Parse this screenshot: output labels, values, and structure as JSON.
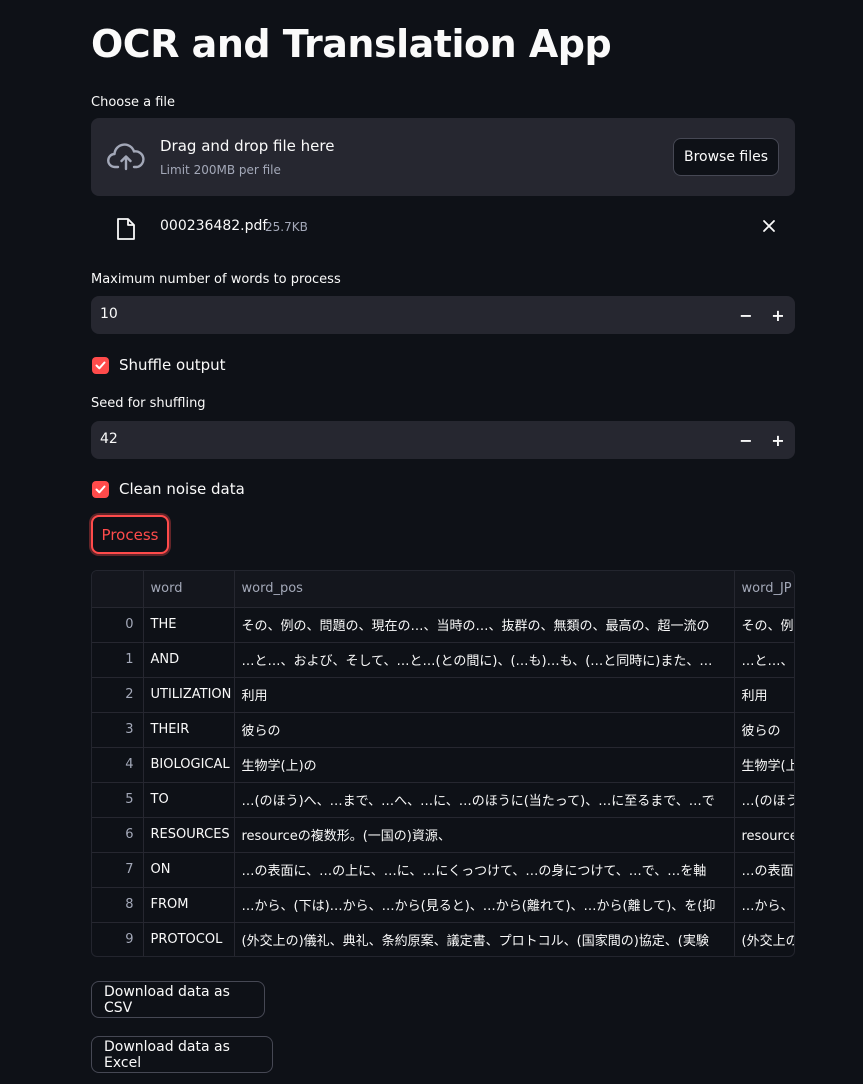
{
  "app": {
    "title": "OCR and Translation App"
  },
  "uploader": {
    "label": "Choose a file",
    "drop_title": "Drag and drop file here",
    "drop_limit": "Limit 200MB per file",
    "browse_label": "Browse files",
    "file": {
      "name": "000236482.pdf",
      "size": "25.7KB"
    }
  },
  "max_words": {
    "label": "Maximum number of words to process",
    "value": "10",
    "minus": "−",
    "plus": "+"
  },
  "shuffle": {
    "label": "Shuffle output",
    "checked": true
  },
  "seed": {
    "label": "Seed for shuffling",
    "value": "42",
    "minus": "−",
    "plus": "+"
  },
  "clean": {
    "label": "Clean noise data",
    "checked": true
  },
  "process_label": "Process",
  "table": {
    "columns": [
      "",
      "word",
      "word_pos",
      "word_JP"
    ],
    "rows": [
      [
        "0",
        "THE",
        "その、例の、問題の、現在の…、当時の…、抜群の、無類の、最高の、超一流の",
        "その、例"
      ],
      [
        "1",
        "AND",
        "…と…、および、そして、…と…(との間に)、(…も)…も、(…と同時に)また、…",
        "…と…、"
      ],
      [
        "2",
        "UTILIZATION",
        "利用",
        "利用"
      ],
      [
        "3",
        "THEIR",
        "彼らの",
        "彼らの"
      ],
      [
        "4",
        "BIOLOGICAL",
        "生物学(上)の",
        "生物学(上"
      ],
      [
        "5",
        "TO",
        "…(のほう)へ、…まで、…へ、…に、…のほうに(当たって)、…に至るまで、…で",
        "…(のほう"
      ],
      [
        "6",
        "RESOURCES",
        "resourceの複数形。(一国の)資源、",
        "resourceの"
      ],
      [
        "7",
        "ON",
        "…の表面に、…の上に、…に、…にくっつけて、…の身につけて、…で、…を軸",
        "…の表面"
      ],
      [
        "8",
        "FROM",
        "…から、(下は)…から、…から(見ると)、…から(離れて)、…から(離して)、を(抑",
        "…から、"
      ],
      [
        "9",
        "PROTOCOL",
        "(外交上の)儀礼、典礼、条約原案、議定書、プロトコル、(国家間の)協定、(実験",
        "(外交上の"
      ]
    ]
  },
  "downloads": {
    "csv_label": "Download data as CSV",
    "excel_label": "Download data as Excel"
  },
  "colors": {
    "accent": "#ff4b4b",
    "background": "#0e1117",
    "input_bg": "#262730"
  },
  "icons": {
    "upload": "cloud-upload-icon",
    "file": "file-icon",
    "close": "close-icon",
    "check": "check-icon"
  }
}
